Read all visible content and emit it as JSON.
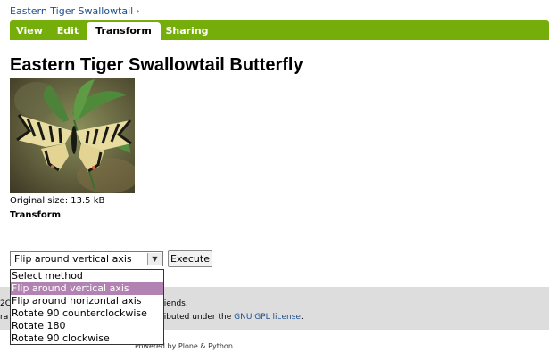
{
  "breadcrumb": {
    "item": "Eastern Tiger Swallowtail",
    "separator": "›"
  },
  "tabs": [
    {
      "label": "View",
      "active": false
    },
    {
      "label": "Edit",
      "active": false
    },
    {
      "label": "Transform",
      "active": true
    },
    {
      "label": "Sharing",
      "active": false
    }
  ],
  "page_title": "Eastern Tiger Swallowtail Butterfly",
  "image": {
    "alt": "Eastern Tiger Swallowtail butterfly on a leaf"
  },
  "original_size": "Original size: 13.5 kB",
  "transform_label": "Transform",
  "select": {
    "current": "Flip around vertical axis",
    "options": [
      "Select method",
      "Flip around vertical axis",
      "Flip around horizontal axis",
      "Rotate 90 counterclockwise",
      "Rotate 180",
      "Rotate 90 clockwise"
    ],
    "highlighted_index": 1
  },
  "execute_label": "Execute",
  "footer": {
    "line1_lead": "2C",
    "line1_rest": "riends.",
    "line2_lead": "ra",
    "line2_rest": "ributed under the ",
    "license_link": "GNU GPL license",
    "line2_end": ".",
    "powered": "Powered by Plone & Python"
  },
  "colors": {
    "tabbar": "#75ad0a",
    "link": "#1d4f8c",
    "option_highlight": "#b282b2",
    "footer_band": "#dddddd"
  }
}
